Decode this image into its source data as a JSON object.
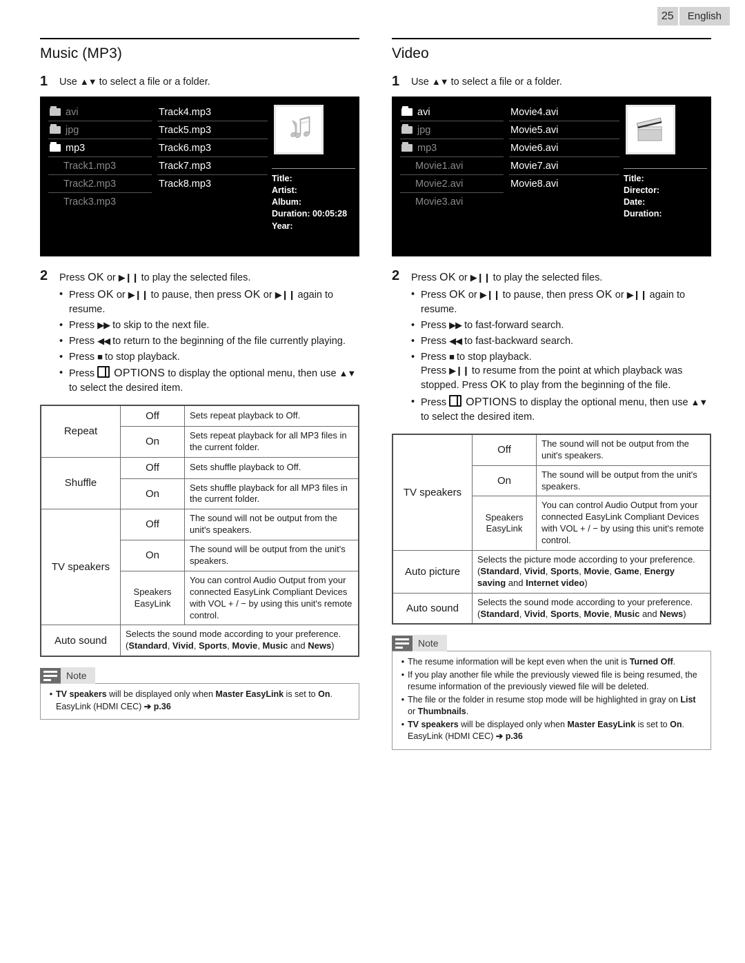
{
  "header": {
    "page_number": "25",
    "language": "English"
  },
  "left": {
    "title": "Music (MP3)",
    "step1": {
      "num": "1",
      "text_before": "Use",
      "arrows": "▲▼",
      "text_after": "to select a file or a folder."
    },
    "screen": {
      "col1": [
        {
          "label": "avi",
          "type": "folder",
          "selected": false
        },
        {
          "label": "jpg",
          "type": "folder",
          "selected": false
        },
        {
          "label": "mp3",
          "type": "folder",
          "selected": true
        },
        {
          "label": "Track1.mp3",
          "type": "file",
          "selected": false
        },
        {
          "label": "Track2.mp3",
          "type": "file",
          "selected": false
        },
        {
          "label": "Track3.mp3",
          "type": "file",
          "selected": false
        }
      ],
      "col2": [
        {
          "label": "Track4.mp3",
          "selected": true
        },
        {
          "label": "Track5.mp3",
          "selected": true
        },
        {
          "label": "Track6.mp3",
          "selected": true
        },
        {
          "label": "Track7.mp3",
          "selected": true
        },
        {
          "label": "Track8.mp3",
          "selected": true
        }
      ],
      "thumb_icon": "music-note-icon",
      "meta": [
        "Title:",
        "Artist:",
        "Album:",
        "Duration: 00:05:28",
        "Year:"
      ]
    },
    "step2": {
      "num": "2",
      "main": "Press OK or ▶❙❙ to play the selected files.",
      "bullets": [
        "Press OK or ▶❙❙ to pause, then press OK or ▶❙❙ again to resume.",
        "Press ▶▶ to skip to the next file.",
        "Press ◀◀ to return to the beginning of the file currently playing.",
        "Press ■ to stop playback.",
        "Press ⎙ OPTIONS to display the optional menu, then use ▲▼ to select the desired item."
      ]
    },
    "table": [
      {
        "name": "Repeat",
        "rows": [
          {
            "value": "Off",
            "desc": "Sets repeat playback to Off."
          },
          {
            "value": "On",
            "desc": "Sets repeat playback for all MP3 files in the current folder."
          }
        ]
      },
      {
        "name": "Shuffle",
        "rows": [
          {
            "value": "Off",
            "desc": "Sets shuffle playback to Off."
          },
          {
            "value": "On",
            "desc": "Sets shuffle playback for all MP3 files in the current folder."
          }
        ]
      },
      {
        "name": "TV speakers",
        "rows": [
          {
            "value": "Off",
            "desc": "The sound will not be output from the unit's speakers."
          },
          {
            "value": "On",
            "desc": "The sound will be output from the unit's speakers."
          },
          {
            "value": "Speakers EasyLink",
            "desc": "You can control Audio Output from your connected EasyLink Compliant Devices with VOL + / − by using this unit's remote control."
          }
        ]
      },
      {
        "name": "Auto sound",
        "rows": [
          {
            "value": "",
            "desc": "Selects the sound mode according to your preference. (Standard, Vivid, Sports, Movie, Music and News)"
          }
        ]
      }
    ],
    "note": {
      "title": "Note",
      "items": [
        "TV speakers will be displayed only when Master EasyLink is set to On. EasyLink (HDMI CEC) ➔ p.36"
      ]
    }
  },
  "right": {
    "title": "Video",
    "step1": {
      "num": "1",
      "text_before": "Use",
      "arrows": "▲▼",
      "text_after": "to select a file or a folder."
    },
    "screen": {
      "col1": [
        {
          "label": "avi",
          "type": "folder",
          "selected": true
        },
        {
          "label": "jpg",
          "type": "folder",
          "selected": false
        },
        {
          "label": "mp3",
          "type": "folder",
          "selected": false
        },
        {
          "label": "Movie1.avi",
          "type": "file",
          "selected": false
        },
        {
          "label": "Movie2.avi",
          "type": "file",
          "selected": false
        },
        {
          "label": "Movie3.avi",
          "type": "file",
          "selected": false
        }
      ],
      "col2": [
        {
          "label": "Movie4.avi",
          "selected": true
        },
        {
          "label": "Movie5.avi",
          "selected": true
        },
        {
          "label": "Movie6.avi",
          "selected": true
        },
        {
          "label": "Movie7.avi",
          "selected": true
        },
        {
          "label": "Movie8.avi",
          "selected": true
        }
      ],
      "thumb_icon": "clapperboard-icon",
      "meta": [
        "Title:",
        "Director:",
        "Date:",
        "Duration:"
      ]
    },
    "step2": {
      "num": "2",
      "main": "Press OK or ▶❙❙ to play the selected files.",
      "bullets": [
        "Press OK or ▶❙❙ to pause, then press OK or ▶❙❙ again to resume.",
        "Press ▶▶ to fast-forward search.",
        "Press ◀◀ to fast-backward search.",
        "Press ■ to stop playback.",
        "Press ⎙ OPTIONS to display the optional menu, then use ▲▼ to select the desired item."
      ],
      "sub_after_stop": "Press ▶❙❙ to resume from the point at which playback was stopped. Press OK to play from the beginning of the file."
    },
    "table": [
      {
        "name": "TV speakers",
        "rows": [
          {
            "value": "Off",
            "desc": "The sound will not be output from the unit's speakers."
          },
          {
            "value": "On",
            "desc": "The sound will be output from the unit's speakers."
          },
          {
            "value": "Speakers EasyLink",
            "desc": "You can control Audio Output from your connected EasyLink Compliant Devices with VOL + / − by using this unit's remote control."
          }
        ]
      },
      {
        "name": "Auto picture",
        "rows": [
          {
            "value": "",
            "desc": "Selects the picture mode according to your preference. (Standard, Vivid, Sports, Movie, Game, Energy saving and Internet video)"
          }
        ]
      },
      {
        "name": "Auto sound",
        "rows": [
          {
            "value": "",
            "desc": "Selects the sound mode according to your preference. (Standard, Vivid, Sports, Movie, Music and News)"
          }
        ]
      }
    ],
    "note": {
      "title": "Note",
      "items": [
        "The resume information will be kept even when the unit is Turned Off.",
        "If you play another file while the previously viewed file is being resumed, the resume information of the previously viewed file will be deleted.",
        "The file or the folder in resume stop mode will be highlighted in gray on List or Thumbnails.",
        "TV speakers will be displayed only when Master EasyLink is set to On. EasyLink (HDMI CEC) ➔ p.36"
      ]
    }
  }
}
